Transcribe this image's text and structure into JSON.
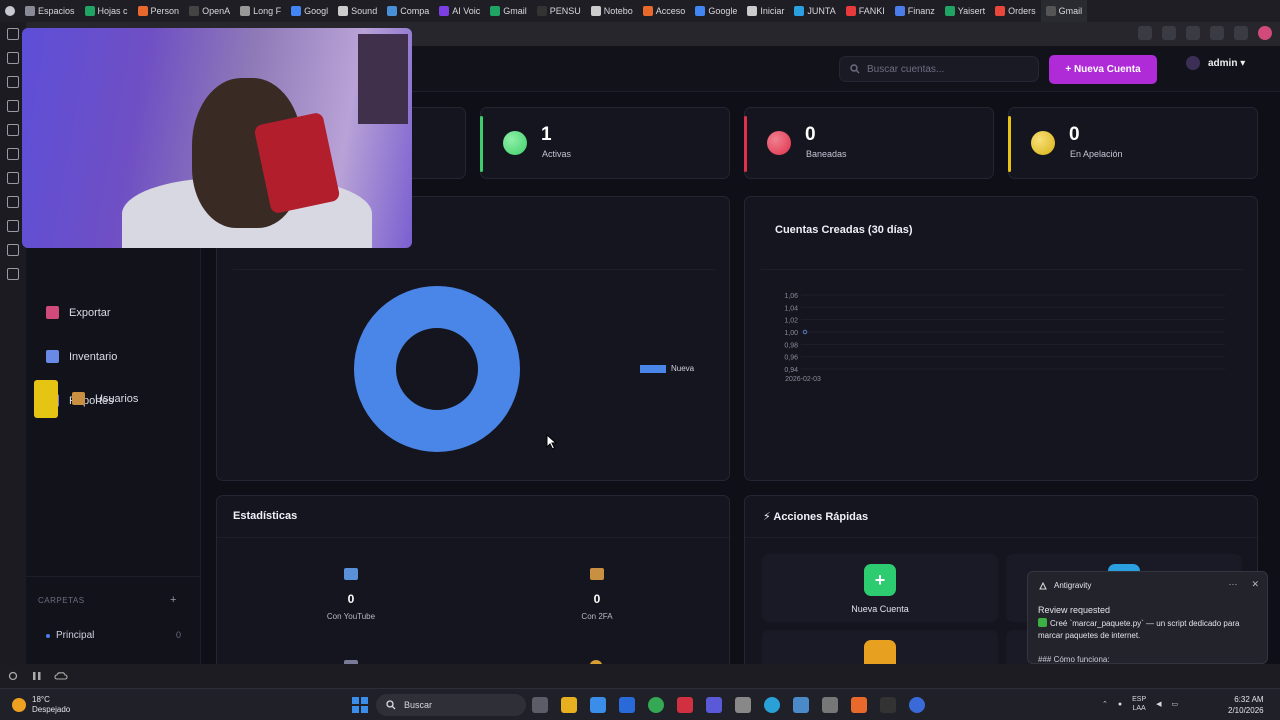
{
  "browser": {
    "tabs": [
      {
        "label": "Espacios",
        "color": "#8a8a96"
      },
      {
        "label": "Hojas c",
        "color": "#1fa463"
      },
      {
        "label": "Person",
        "color": "#e8692b"
      },
      {
        "label": "OpenA",
        "color": "#444"
      },
      {
        "label": "Long F",
        "color": "#999"
      },
      {
        "label": "Googl",
        "color": "#4285f4"
      },
      {
        "label": "Sound",
        "color": "#cccccc"
      },
      {
        "label": "Compa",
        "color": "#4a90d9"
      },
      {
        "label": "AI Voic",
        "color": "#7b3fe4"
      },
      {
        "label": "Gmail",
        "color": "#1fa463"
      },
      {
        "label": "PENSU",
        "color": "#333"
      },
      {
        "label": "Notebo",
        "color": "#cccccc"
      },
      {
        "label": "Acceso",
        "color": "#e8692b"
      },
      {
        "label": "Google",
        "color": "#4285f4"
      },
      {
        "label": "Iniciar",
        "color": "#cccccc"
      },
      {
        "label": "JUNTA",
        "color": "#2aa0e0"
      },
      {
        "label": "FANKI",
        "color": "#e83a3a"
      },
      {
        "label": "Finanz",
        "color": "#4a7de8"
      },
      {
        "label": "Yaisert",
        "color": "#1fa463"
      },
      {
        "label": "Orders",
        "color": "#e8473a"
      },
      {
        "label": "Gmail",
        "color": "#555"
      }
    ]
  },
  "topbar": {
    "search_placeholder": "Buscar cuentas...",
    "new_account_label": "+ Nueva Cuenta",
    "user_name": "admin ▾"
  },
  "sidebar": {
    "items": [
      {
        "label": "Exportar",
        "color": "#d04a7a"
      },
      {
        "label": "Inventario",
        "color": "#6a8ae8"
      },
      {
        "label": "Reportes",
        "color": "#7a7ae8"
      },
      {
        "label": "Usuarios",
        "color": "#c89040"
      }
    ],
    "folders_label": "CARPETAS",
    "folders_add": "+",
    "folders": [
      {
        "label": "Principal",
        "count": "0"
      }
    ]
  },
  "stats": [
    {
      "value": "1",
      "label": "Activas",
      "color": "#3fcf6a",
      "edge": "#3fcf6a"
    },
    {
      "value": "0",
      "label": "Baneadas",
      "color": "#e0304a",
      "edge": "#e0304a"
    },
    {
      "value": "0",
      "label": "En Apelación",
      "color": "#e6c414",
      "edge": "#e6c414"
    }
  ],
  "donut": {
    "legend": "Nueva",
    "color": "#4a86e8"
  },
  "chart_data": {
    "type": "line",
    "title": "Cuentas Creadas (30 días)",
    "x": [
      "2026-02-03"
    ],
    "series": [
      {
        "values": [
          1
        ]
      }
    ],
    "yticks": [
      "1,06",
      "1,04",
      "1,02",
      "1,00",
      "0,98",
      "0,96",
      "0,94"
    ],
    "ylim": [
      0.94,
      1.06
    ]
  },
  "estadisticas": {
    "title": "Estadísticas",
    "items": [
      {
        "value": "0",
        "label": "Con YouTube",
        "color": "#5a90d8"
      },
      {
        "value": "0",
        "label": "Con 2FA",
        "color": "#c89040"
      }
    ]
  },
  "acciones": {
    "title": "⚡ Acciones Rápidas",
    "items": [
      {
        "label": "Nueva Cuenta",
        "icon": "+",
        "color": "#2ecc71"
      }
    ]
  },
  "notification": {
    "app": "Antigravity",
    "heading": "Review requested",
    "body": "Creé `marcar_paquete.py` — un script dedicado para marcar paquetes de internet.",
    "footer": "### Cómo funciona:"
  },
  "taskbar": {
    "temp": "18°C",
    "weather": "Despejado",
    "search": "Buscar",
    "lang1": "ESP",
    "lang2": "LAA",
    "time": "6:32 AM",
    "date": "2/10/2026"
  }
}
